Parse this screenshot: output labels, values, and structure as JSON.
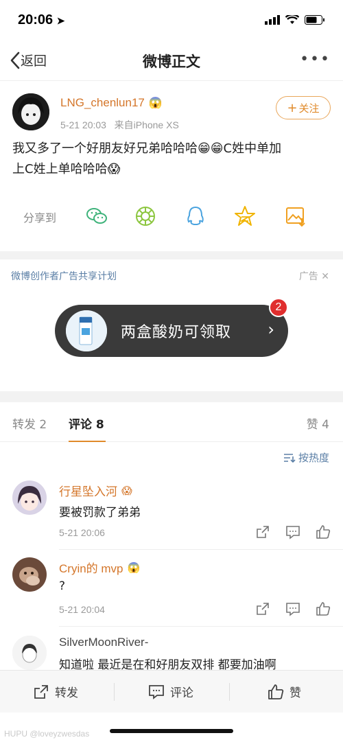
{
  "status": {
    "time": "20:06"
  },
  "nav": {
    "back_label": "返回",
    "title": "微博正文",
    "more": "•••"
  },
  "post": {
    "author": "LNG_chenlun17",
    "time": "5-21 20:03",
    "source": "来自iPhone XS",
    "follow_label": "关注",
    "text_line1": "我又多了一个好朋友好兄弟哈哈哈😁😁C姓中单加",
    "text_line2": "上C姓上单哈哈哈😱",
    "share_label": "分享到",
    "share_icons": [
      "wechat-icon",
      "moments-icon",
      "qq-icon",
      "qzone-icon",
      "save-image-icon"
    ]
  },
  "ad": {
    "title": "微博创作者广告共享计划",
    "tag": "广告",
    "cta": "两盒酸奶可领取",
    "badge": "2"
  },
  "tabs": {
    "repost": "转发 2",
    "comment": "评论 8",
    "like": "赞 4"
  },
  "sort_label": "按热度",
  "comments": [
    {
      "name": "行星坠入河",
      "text": "要被罚款了弟弟",
      "time": "5-21 20:06"
    },
    {
      "name": "Cryin的 mvp",
      "text": "?",
      "time": "5-21 20:04"
    },
    {
      "name": "SilverMoonRiver-",
      "text": "知道啦 最近是在和好朋友双排 都要加油啊"
    }
  ],
  "bottom": {
    "repost": "转发",
    "comment": "评论",
    "like": "赞"
  },
  "watermark": "HUPU @loveyzwesdas",
  "colors": {
    "accent": "#e08a2a",
    "link_blue": "#5b7fa6",
    "name_orange": "#d4762a",
    "badge_red": "#e02e2e"
  }
}
